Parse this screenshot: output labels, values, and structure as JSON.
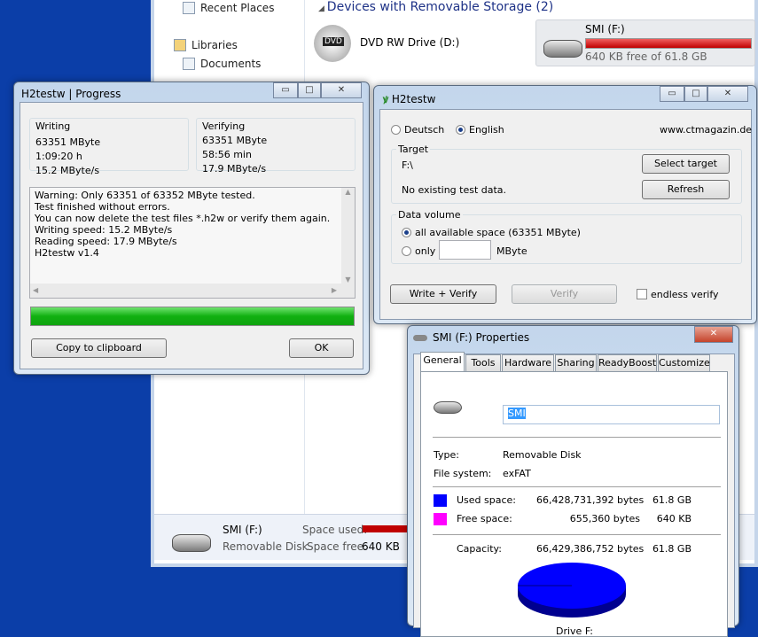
{
  "explorer": {
    "nav": [
      {
        "label": "Recent Places"
      },
      {
        "label": "Libraries"
      },
      {
        "label": "Documents"
      }
    ],
    "group_title": "Devices with Removable Storage (2)",
    "devices": [
      {
        "name": "DVD RW Drive (D:)",
        "badge": "DVD"
      },
      {
        "name": "SMI (F:)",
        "free": "640 KB free of 61.8 GB",
        "used_fraction": 0.99999
      }
    ],
    "details": {
      "name": "SMI (F:)",
      "type": "Removable Disk",
      "used_label": "Space used:",
      "free_label": "Space free:",
      "free_value": "640 KB"
    }
  },
  "progress": {
    "title": "H2testw | Progress",
    "writing": {
      "label": "Writing",
      "lines": [
        "63351 MByte",
        "1:09:20 h",
        "15.2 MByte/s"
      ]
    },
    "verifying": {
      "label": "Verifying",
      "lines": [
        "63351 MByte",
        "58:56 min",
        "17.9 MByte/s"
      ]
    },
    "log": [
      "Warning: Only 63351 of 63352 MByte tested.",
      "Test finished without errors.",
      "You can now delete the test files *.h2w or verify them again.",
      "Writing speed: 15.2 MByte/s",
      "Reading speed: 17.9 MByte/s",
      "H2testw v1.4"
    ],
    "progress_percent": 100,
    "copy_button": "Copy to clipboard",
    "ok_button": "OK"
  },
  "h2testw": {
    "title": "H2testw",
    "lang": [
      "Deutsch",
      "English"
    ],
    "selected_lang": "English",
    "website": "www.ctmagazin.de",
    "target_label": "Target",
    "target_path": "F:\\",
    "status": "No existing test data.",
    "select_target": "Select target",
    "refresh": "Refresh",
    "volume_label": "Data volume",
    "all_space": "all available space (63351 MByte)",
    "only": "only",
    "only_value": "",
    "unit": "MByte",
    "write_verify": "Write + Verify",
    "verify": "Verify",
    "endless": "endless verify"
  },
  "props": {
    "title": "SMI (F:) Properties",
    "tabs": [
      "General",
      "Tools",
      "Hardware",
      "Sharing",
      "ReadyBoost",
      "Customize"
    ],
    "name_value": "SMI",
    "type_label": "Type:",
    "type_value": "Removable Disk",
    "fs_label": "File system:",
    "fs_value": "exFAT",
    "used_label": "Used space:",
    "used_bytes": "66,428,731,392 bytes",
    "used_size": "61.8 GB",
    "free_label": "Free space:",
    "free_bytes": "655,360 bytes",
    "free_size": "640 KB",
    "cap_label": "Capacity:",
    "cap_bytes": "66,429,386,752 bytes",
    "cap_size": "61.8 GB",
    "drive_label": "Drive F:",
    "colors": {
      "used": "#0000ff",
      "free": "#ff00ff"
    }
  }
}
